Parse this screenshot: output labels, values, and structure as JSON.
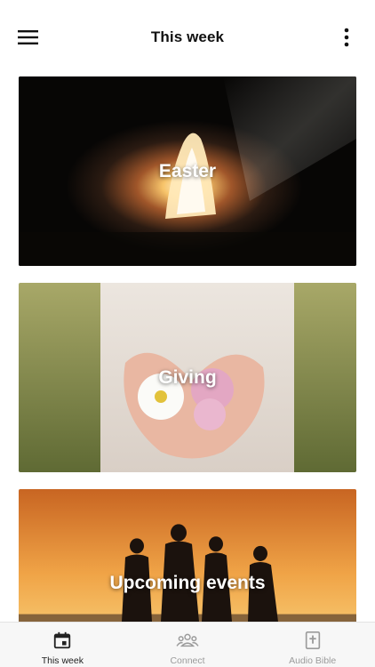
{
  "header": {
    "title": "This week",
    "menu_icon": "hamburger-menu-icon",
    "more_icon": "vertical-ellipsis-icon"
  },
  "cards": [
    {
      "label": "Easter",
      "image": "empty-tomb-light-photo"
    },
    {
      "label": "Giving",
      "image": "cupped-hands-flowers-photo"
    },
    {
      "label": "Upcoming events",
      "image": "sunset-silhouettes-photo"
    }
  ],
  "tabbar": {
    "tabs": [
      {
        "label": "This week",
        "icon": "calendar-icon",
        "active": true
      },
      {
        "label": "Connect",
        "icon": "people-group-icon",
        "active": false
      },
      {
        "label": "Audio Bible",
        "icon": "bible-cross-icon",
        "active": false
      }
    ]
  },
  "colors": {
    "active_tab": "#222222",
    "inactive_tab": "#9b9b9b",
    "tabbar_bg": "#f7f7f7"
  }
}
